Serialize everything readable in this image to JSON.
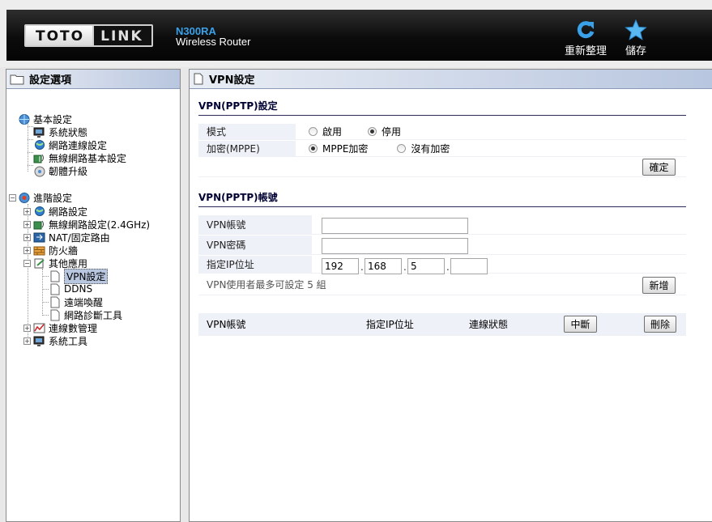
{
  "header": {
    "logo_left": "TOTO",
    "logo_right": "LINK",
    "model": "N300RA",
    "subtitle": "Wireless Router",
    "reload_label": "重新整理",
    "save_label": "儲存"
  },
  "sidebar": {
    "title": "設定選項",
    "groups": [
      {
        "label": "基本設定",
        "items": [
          "系統狀態",
          "網路連線設定",
          "無線網路基本設定",
          "韌體升級"
        ]
      },
      {
        "label": "進階設定",
        "items": [
          "網路設定",
          "無線網路設定(2.4GHz)",
          "NAT/固定路由",
          "防火牆",
          "其他應用",
          "VPN設定",
          "DDNS",
          "遠端喚醒",
          "網路診斷工具",
          "連線數管理",
          "系統工具"
        ]
      }
    ]
  },
  "main": {
    "title": "VPN設定",
    "pptp_section": "VPN(PPTP)設定",
    "mode_label": "模式",
    "mode_enable": "啟用",
    "mode_disable": "停用",
    "mode_selected": "停用",
    "encrypt_label": "加密(MPPE)",
    "encrypt_mppe": "MPPE加密",
    "encrypt_none": "沒有加密",
    "encrypt_selected": "MPPE加密",
    "confirm_button": "確定",
    "account_section": "VPN(PPTP)帳號",
    "account_label": "VPN帳號",
    "account_value": "",
    "password_label": "VPN密碼",
    "password_value": "",
    "ip_label": "指定IP位址",
    "ip": [
      "192",
      "168",
      "5",
      ""
    ],
    "max_note": "VPN使用者最多可設定 5 組",
    "add_button": "新增",
    "table": {
      "col_account": "VPN帳號",
      "col_ip": "指定IP位址",
      "col_status": "連線狀態",
      "disconnect_button": "中斷",
      "delete_button": "刪除"
    }
  },
  "colors": {
    "accent": "#3aa0e8",
    "panel_header": "#b8c6df",
    "label_bg": "#eef1f8"
  }
}
